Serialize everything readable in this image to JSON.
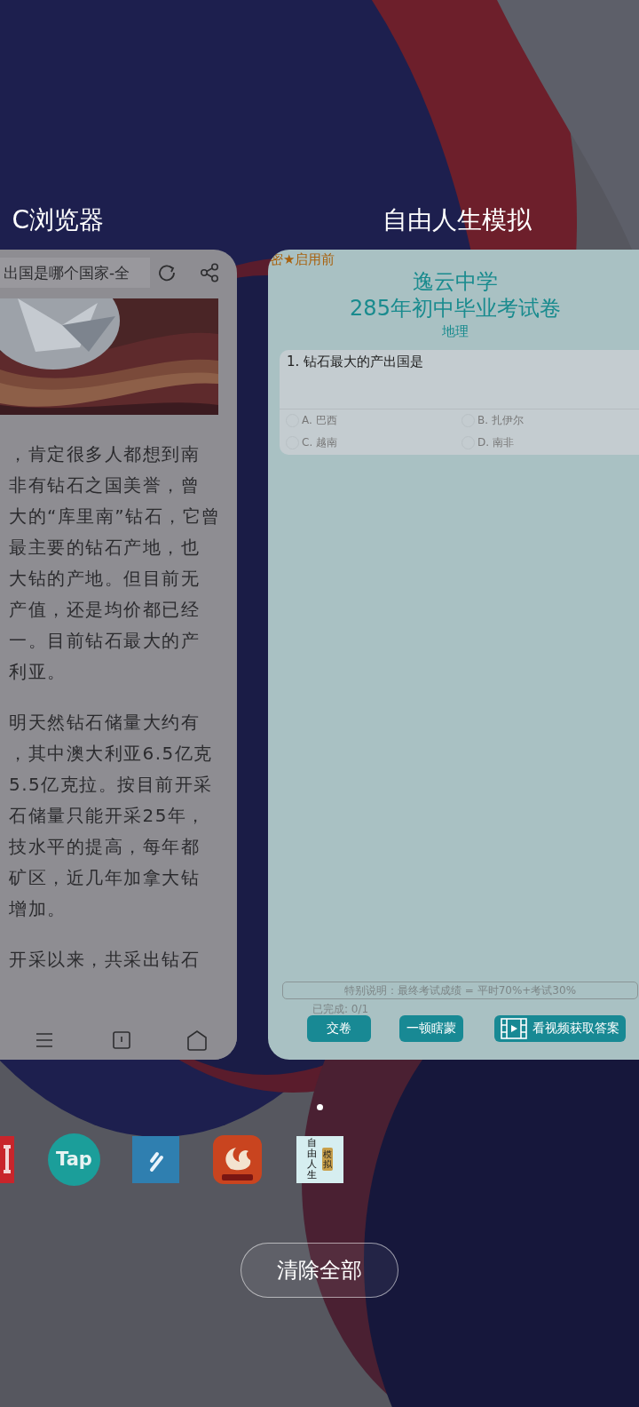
{
  "recent_apps": [
    {
      "kind": "browser",
      "title": "C浏览器",
      "address": "出国是哪个国家-全",
      "paragraphs": [
        [
          "，肯定很多人都想到南",
          "非有钻石之国美誉，曾",
          "大的“库里南”钻石，它曾",
          "最主要的钻石产地，也",
          "大钻的产地。但目前无",
          "产值，还是均价都已经",
          "一。目前钻石最大的产",
          "利亚。"
        ],
        [
          "明天然钻石储量大约有",
          "，其中澳大利亚6.5亿克",
          "5.5亿克拉。按目前开采",
          "石储量只能开采25年，",
          "技水平的提高，每年都",
          "矿区，近几年加拿大钻",
          "增加。"
        ],
        [
          "开采以来，共采出钻石"
        ]
      ]
    },
    {
      "kind": "exam",
      "title": "自由人生模拟",
      "secret_mark": "密★启用前",
      "school": "逸云中学",
      "exam_title": "285年初中毕业考试卷",
      "subject": "地理",
      "question": {
        "text": "1. 钻石最大的产出国是",
        "options": [
          {
            "label": "A. 巴西",
            "selected": false
          },
          {
            "label": "B. 扎伊尔",
            "selected": false
          },
          {
            "label": "C. 越南",
            "selected": false
          },
          {
            "label": "D. 南非",
            "selected": false
          }
        ]
      },
      "note": "特别说明：最终考试成绩 = 平时70%+考试30%",
      "progress": "已完成: 0/1",
      "buttons": [
        {
          "kind": "plain",
          "label": "交卷"
        },
        {
          "kind": "plain",
          "label": "一顿瞎蒙"
        },
        {
          "kind": "video",
          "label": "看视频获取答案"
        }
      ]
    }
  ],
  "dock": [
    {
      "kind": "red-partial"
    },
    {
      "kind": "tap",
      "label": "Tap"
    },
    {
      "kind": "feather"
    },
    {
      "kind": "uc"
    },
    {
      "kind": "life-sim",
      "label": "自由人生",
      "label_2": "模拟"
    }
  ],
  "clear_button": "清除全部"
}
